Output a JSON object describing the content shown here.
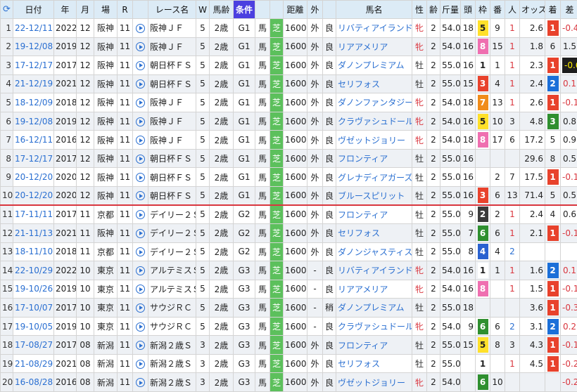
{
  "headers": {
    "refresh_icon": "refresh-icon",
    "no": "",
    "date": "日付",
    "year": "年",
    "month": "月",
    "course": "場",
    "race_no": "R",
    "video": "",
    "race_name": "レース名",
    "week": "W",
    "age": "馬齢",
    "condition": "条件",
    "horse_cond": "",
    "surface": "",
    "distance": "距離",
    "inout": "外",
    "going": "",
    "horse": "馬名",
    "sex": "性",
    "horse_age": "齢",
    "weight": "斤量",
    "runners": "頭",
    "waku": "枠",
    "number": "番",
    "popularity": "人",
    "odds": "オッズ",
    "finish": "着",
    "margin": "差"
  },
  "colors": {
    "header_bg": "#dcebf6",
    "condition_header_bg": "#4b3fe0",
    "turf_green": "#5cc05c",
    "link_blue": "#2a6fd1",
    "female_red": "#d9363e",
    "separator_red": "#d9363e",
    "finish_1": "#e8422c",
    "finish_2": "#1b6fd8",
    "finish_3": "#2f8f2f",
    "waku_colors": {
      "1": "#ffffff",
      "2": "#3a3a3a",
      "3": "#e8422c",
      "4": "#2a62d0",
      "5": "#ffe02a",
      "6": "#2f8f2f",
      "7": "#f08c1a",
      "8": "#ef6fb0"
    }
  },
  "rows": [
    {
      "no": "1",
      "date": "22-12/11",
      "year": "2022",
      "month": "12",
      "course": "阪神",
      "r": "11",
      "race": "阪神ＪＦ",
      "w": "5",
      "age": "2歳",
      "grade": "G1",
      "hc": "馬",
      "surf": "芝",
      "dist": "1600",
      "io": "外",
      "going": "良",
      "horse": "リバティアイランド",
      "sex": "牝",
      "hage": "2",
      "kg": "54.0",
      "heads": "18",
      "waku": "5",
      "num": "9",
      "pop": "1",
      "odds": "2.6",
      "fin": "1",
      "diff": "-0.4"
    },
    {
      "no": "2",
      "date": "19-12/08",
      "year": "2019",
      "month": "12",
      "course": "阪神",
      "r": "11",
      "race": "阪神ＪＦ",
      "w": "5",
      "age": "2歳",
      "grade": "G1",
      "hc": "馬",
      "surf": "芝",
      "dist": "1600",
      "io": "外",
      "going": "良",
      "horse": "リアアメリア",
      "sex": "牝",
      "hage": "2",
      "kg": "54.0",
      "heads": "16",
      "waku": "8",
      "num": "15",
      "pop": "1",
      "odds": "1.8",
      "fin": "6",
      "diff": "1.5"
    },
    {
      "no": "3",
      "date": "17-12/17",
      "year": "2017",
      "month": "12",
      "course": "阪神",
      "r": "11",
      "race": "朝日杯ＦＳ",
      "w": "5",
      "age": "2歳",
      "grade": "G1",
      "hc": "馬",
      "surf": "芝",
      "dist": "1600",
      "io": "外",
      "going": "良",
      "horse": "ダノンプレミアム",
      "sex": "牡",
      "hage": "2",
      "kg": "55.0",
      "heads": "16",
      "waku": "1",
      "num": "1",
      "pop": "1",
      "odds": "2.3",
      "fin": "1",
      "diff": "-0.6"
    },
    {
      "no": "4",
      "date": "21-12/19",
      "year": "2021",
      "month": "12",
      "course": "阪神",
      "r": "11",
      "race": "朝日杯ＦＳ",
      "w": "5",
      "age": "2歳",
      "grade": "G1",
      "hc": "馬",
      "surf": "芝",
      "dist": "1600",
      "io": "外",
      "going": "良",
      "horse": "セリフォス",
      "sex": "牡",
      "hage": "2",
      "kg": "55.0",
      "heads": "15",
      "waku": "3",
      "num": "4",
      "pop": "1",
      "odds": "2.4",
      "fin": "2",
      "diff": "0.1"
    },
    {
      "no": "5",
      "date": "18-12/09",
      "year": "2018",
      "month": "12",
      "course": "阪神",
      "r": "11",
      "race": "阪神ＪＦ",
      "w": "5",
      "age": "2歳",
      "grade": "G1",
      "hc": "馬",
      "surf": "芝",
      "dist": "1600",
      "io": "外",
      "going": "良",
      "horse": "ダノンファンタジー",
      "sex": "牝",
      "hage": "2",
      "kg": "54.0",
      "heads": "18",
      "waku": "7",
      "num": "13",
      "pop": "1",
      "odds": "2.6",
      "fin": "1",
      "diff": "-0.1"
    },
    {
      "no": "6",
      "date": "19-12/08",
      "year": "2019",
      "month": "12",
      "course": "阪神",
      "r": "11",
      "race": "阪神ＪＦ",
      "w": "5",
      "age": "2歳",
      "grade": "G1",
      "hc": "馬",
      "surf": "芝",
      "dist": "1600",
      "io": "外",
      "going": "良",
      "horse": "クラヴァシュドール",
      "sex": "牝",
      "hage": "2",
      "kg": "54.0",
      "heads": "16",
      "waku": "5",
      "num": "10",
      "pop": "3",
      "odds": "4.8",
      "fin": "3",
      "diff": "0.8"
    },
    {
      "no": "7",
      "date": "16-12/11",
      "year": "2016",
      "month": "12",
      "course": "阪神",
      "r": "11",
      "race": "阪神ＪＦ",
      "w": "5",
      "age": "2歳",
      "grade": "G1",
      "hc": "馬",
      "surf": "芝",
      "dist": "1600",
      "io": "外",
      "going": "良",
      "horse": "ヴゼットジョリー",
      "sex": "牝",
      "hage": "2",
      "kg": "54.0",
      "heads": "18",
      "waku": "8",
      "num": "17",
      "pop": "6",
      "odds": "17.2",
      "fin": "5",
      "diff": "0.9"
    },
    {
      "no": "8",
      "date": "17-12/17",
      "year": "2017",
      "month": "12",
      "course": "阪神",
      "r": "11",
      "race": "朝日杯ＦＳ",
      "w": "5",
      "age": "2歳",
      "grade": "G1",
      "hc": "馬",
      "surf": "芝",
      "dist": "1600",
      "io": "外",
      "going": "良",
      "horse": "フロンティア",
      "sex": "牡",
      "hage": "2",
      "kg": "55.0",
      "heads": "16",
      "waku": "",
      "num": "",
      "pop": "",
      "odds": "29.6",
      "fin": "8",
      "diff": "0.5"
    },
    {
      "no": "9",
      "date": "20-12/20",
      "year": "2020",
      "month": "12",
      "course": "阪神",
      "r": "11",
      "race": "朝日杯ＦＳ",
      "w": "5",
      "age": "2歳",
      "grade": "G1",
      "hc": "馬",
      "surf": "芝",
      "dist": "1600",
      "io": "外",
      "going": "良",
      "horse": "グレナディアガーズ",
      "sex": "牡",
      "hage": "2",
      "kg": "55.0",
      "heads": "16",
      "waku": "",
      "num": "2",
      "pop": "7",
      "odds": "17.5",
      "fin": "1",
      "diff": "-0.1"
    },
    {
      "no": "10",
      "date": "20-12/20",
      "year": "2020",
      "month": "12",
      "course": "阪神",
      "r": "11",
      "race": "朝日杯ＦＳ",
      "w": "5",
      "age": "2歳",
      "grade": "G1",
      "hc": "馬",
      "surf": "芝",
      "dist": "1600",
      "io": "外",
      "going": "良",
      "horse": "ブルースピリット",
      "sex": "牡",
      "hage": "2",
      "kg": "55.0",
      "heads": "16",
      "waku": "3",
      "num": "6",
      "pop": "13",
      "odds": "71.4",
      "fin": "5",
      "diff": "0.5"
    },
    {
      "no": "11",
      "date": "17-11/11",
      "year": "2017",
      "month": "11",
      "course": "京都",
      "r": "11",
      "race": "デイリー２Ｓ",
      "w": "5",
      "age": "2歳",
      "grade": "G2",
      "hc": "馬",
      "surf": "芝",
      "dist": "1600",
      "io": "外",
      "going": "良",
      "horse": "フロンティア",
      "sex": "牡",
      "hage": "2",
      "kg": "55.0",
      "heads": "9",
      "waku": "2",
      "num": "2",
      "pop": "1",
      "odds": "2.4",
      "fin": "4",
      "diff": "0.6"
    },
    {
      "no": "12",
      "date": "21-11/13",
      "year": "2021",
      "month": "11",
      "course": "阪神",
      "r": "11",
      "race": "デイリー２Ｓ",
      "w": "5",
      "age": "2歳",
      "grade": "G2",
      "hc": "馬",
      "surf": "芝",
      "dist": "1600",
      "io": "外",
      "going": "良",
      "horse": "セリフォス",
      "sex": "牡",
      "hage": "2",
      "kg": "55.0",
      "heads": "7",
      "waku": "6",
      "num": "6",
      "pop": "1",
      "odds": "2.1",
      "fin": "1",
      "diff": "-0.1"
    },
    {
      "no": "13",
      "date": "18-11/10",
      "year": "2018",
      "month": "11",
      "course": "京都",
      "r": "11",
      "race": "デイリー２Ｓ",
      "w": "5",
      "age": "2歳",
      "grade": "G2",
      "hc": "馬",
      "surf": "芝",
      "dist": "1600",
      "io": "外",
      "going": "良",
      "horse": "ダノンジャスティス",
      "sex": "牡",
      "hage": "2",
      "kg": "55.0",
      "heads": "8",
      "waku": "4",
      "num": "4",
      "pop": "2",
      "odds": "",
      "fin": "",
      "diff": ""
    },
    {
      "no": "14",
      "date": "22-10/29",
      "year": "2022",
      "month": "10",
      "course": "東京",
      "r": "11",
      "race": "アルテミスＳ",
      "w": "5",
      "age": "2歳",
      "grade": "G3",
      "hc": "馬",
      "surf": "芝",
      "dist": "1600",
      "io": "-",
      "going": "良",
      "horse": "リバティアイランド",
      "sex": "牝",
      "hage": "2",
      "kg": "54.0",
      "heads": "16",
      "waku": "1",
      "num": "1",
      "pop": "1",
      "odds": "1.6",
      "fin": "2",
      "diff": "0.1"
    },
    {
      "no": "15",
      "date": "19-10/26",
      "year": "2019",
      "month": "10",
      "course": "東京",
      "r": "11",
      "race": "アルテミスＳ",
      "w": "5",
      "age": "2歳",
      "grade": "G3",
      "hc": "馬",
      "surf": "芝",
      "dist": "1600",
      "io": "-",
      "going": "良",
      "horse": "リアアメリア",
      "sex": "牝",
      "hage": "2",
      "kg": "54.0",
      "heads": "16",
      "waku": "8",
      "num": "",
      "pop": "1",
      "odds": "1.5",
      "fin": "1",
      "diff": "-0.1"
    },
    {
      "no": "16",
      "date": "17-10/07",
      "year": "2017",
      "month": "10",
      "course": "東京",
      "r": "11",
      "race": "サウジＲＣ",
      "w": "5",
      "age": "2歳",
      "grade": "G3",
      "hc": "馬",
      "surf": "芝",
      "dist": "1600",
      "io": "-",
      "going": "稍",
      "horse": "ダノンプレミアム",
      "sex": "牡",
      "hage": "2",
      "kg": "55.0",
      "heads": "18",
      "waku": "",
      "num": "",
      "pop": "",
      "odds": "3.6",
      "fin": "1",
      "diff": "-0.3"
    },
    {
      "no": "17",
      "date": "19-10/05",
      "year": "2019",
      "month": "10",
      "course": "東京",
      "r": "11",
      "race": "サウジＲＣ",
      "w": "5",
      "age": "2歳",
      "grade": "G3",
      "hc": "馬",
      "surf": "芝",
      "dist": "1600",
      "io": "-",
      "going": "良",
      "horse": "クラヴァシュドール",
      "sex": "牝",
      "hage": "2",
      "kg": "54.0",
      "heads": "9",
      "waku": "6",
      "num": "6",
      "pop": "2",
      "odds": "3.1",
      "fin": "2",
      "diff": "0.2"
    },
    {
      "no": "18",
      "date": "17-08/27",
      "year": "2017",
      "month": "08",
      "course": "新潟",
      "r": "11",
      "race": "新潟２歳Ｓ",
      "w": "3",
      "age": "2歳",
      "grade": "G3",
      "hc": "馬",
      "surf": "芝",
      "dist": "1600",
      "io": "外",
      "going": "良",
      "horse": "フロンティア",
      "sex": "牡",
      "hage": "2",
      "kg": "55.0",
      "heads": "15",
      "waku": "5",
      "num": "8",
      "pop": "3",
      "odds": "4.3",
      "fin": "1",
      "diff": "-0.1"
    },
    {
      "no": "19",
      "date": "21-08/29",
      "year": "2021",
      "month": "08",
      "course": "新潟",
      "r": "11",
      "race": "新潟２歳Ｓ",
      "w": "3",
      "age": "2歳",
      "grade": "G3",
      "hc": "馬",
      "surf": "芝",
      "dist": "1600",
      "io": "外",
      "going": "良",
      "horse": "セリフォス",
      "sex": "牡",
      "hage": "2",
      "kg": "55.0",
      "heads": "",
      "waku": "1",
      "num": "",
      "pop": "1",
      "odds": "4.5",
      "fin": "1",
      "diff": "-0.2"
    },
    {
      "no": "20",
      "date": "16-08/28",
      "year": "2016",
      "month": "08",
      "course": "新潟",
      "r": "11",
      "race": "新潟２歳Ｓ",
      "w": "3",
      "age": "2歳",
      "grade": "G3",
      "hc": "馬",
      "surf": "芝",
      "dist": "1600",
      "io": "外",
      "going": "良",
      "horse": "ヴゼットジョリー",
      "sex": "牝",
      "hage": "2",
      "kg": "54.0",
      "heads": "",
      "waku": "6",
      "num": "10",
      "pop": "",
      "odds": "",
      "fin": "",
      "diff": "-0.2"
    }
  ]
}
